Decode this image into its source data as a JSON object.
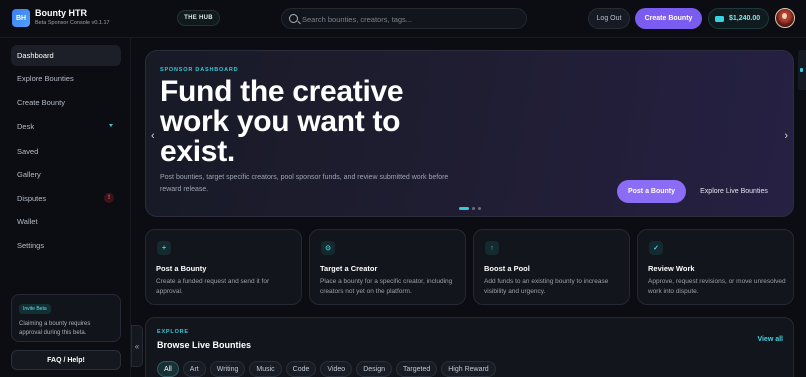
{
  "app": {
    "logo": "BH",
    "title": "Bounty HTR",
    "subtitle": "Beta Sponsor Console v0.1.17"
  },
  "header": {
    "hub_label": "THE HUB",
    "search_placeholder": "Search bounties, creators, tags...",
    "logout_label": "Log Out",
    "create_label": "Create Bounty",
    "balance": "$1,240.00"
  },
  "sidebar": {
    "items": [
      {
        "label": "Dashboard",
        "active": true
      },
      {
        "label": "Explore Bounties"
      },
      {
        "label": "Create Bounty"
      },
      {
        "label": "Desk"
      },
      {
        "label": "Saved"
      },
      {
        "label": "Gallery"
      },
      {
        "label": "Disputes"
      },
      {
        "label": "Wallet"
      },
      {
        "label": "Settings"
      }
    ],
    "disputes_badge": "!",
    "invite_tag": "Invite Beta",
    "invite_text": "Claiming a bounty requires approval during this beta.",
    "faq_label": "FAQ / Help!",
    "collapse_glyph": "«"
  },
  "hero": {
    "kicker": "SPONSOR DASHBOARD",
    "title": "Fund the creative work you want to exist.",
    "description": "Post bounties, target specific creators, pool sponsor funds, and review submitted work before reward release.",
    "primary_label": "Post a Bounty",
    "secondary_label": "Explore Live Bounties",
    "slide_count": 3,
    "active_slide": 1
  },
  "cards": [
    {
      "icon": "+",
      "icon_name": "plus-icon",
      "title": "Post a Bounty",
      "desc": "Create a funded request and send it for approval."
    },
    {
      "icon": "⊙",
      "icon_name": "target-icon",
      "title": "Target a Creator",
      "desc": "Place a bounty for a specific creator, including creators not yet on the platform."
    },
    {
      "icon": "↑",
      "icon_name": "arrow-up-icon",
      "title": "Boost a Pool",
      "desc": "Add funds to an existing bounty to increase visibility and urgency."
    },
    {
      "icon": "✓",
      "icon_name": "check-icon",
      "title": "Review Work",
      "desc": "Approve, request revisions, or move unresolved work into dispute."
    }
  ],
  "browse": {
    "kicker": "EXPLORE",
    "title": "Browse Live Bounties",
    "view_all": "View all",
    "chips": [
      "All",
      "Art",
      "Writing",
      "Music",
      "Code",
      "Video",
      "Design",
      "Targeted",
      "High Reward"
    ],
    "active_chip": 0
  },
  "colors": {
    "accent": "#7b5cf0",
    "teal": "#35c9d8",
    "background": "#0b0d12"
  }
}
